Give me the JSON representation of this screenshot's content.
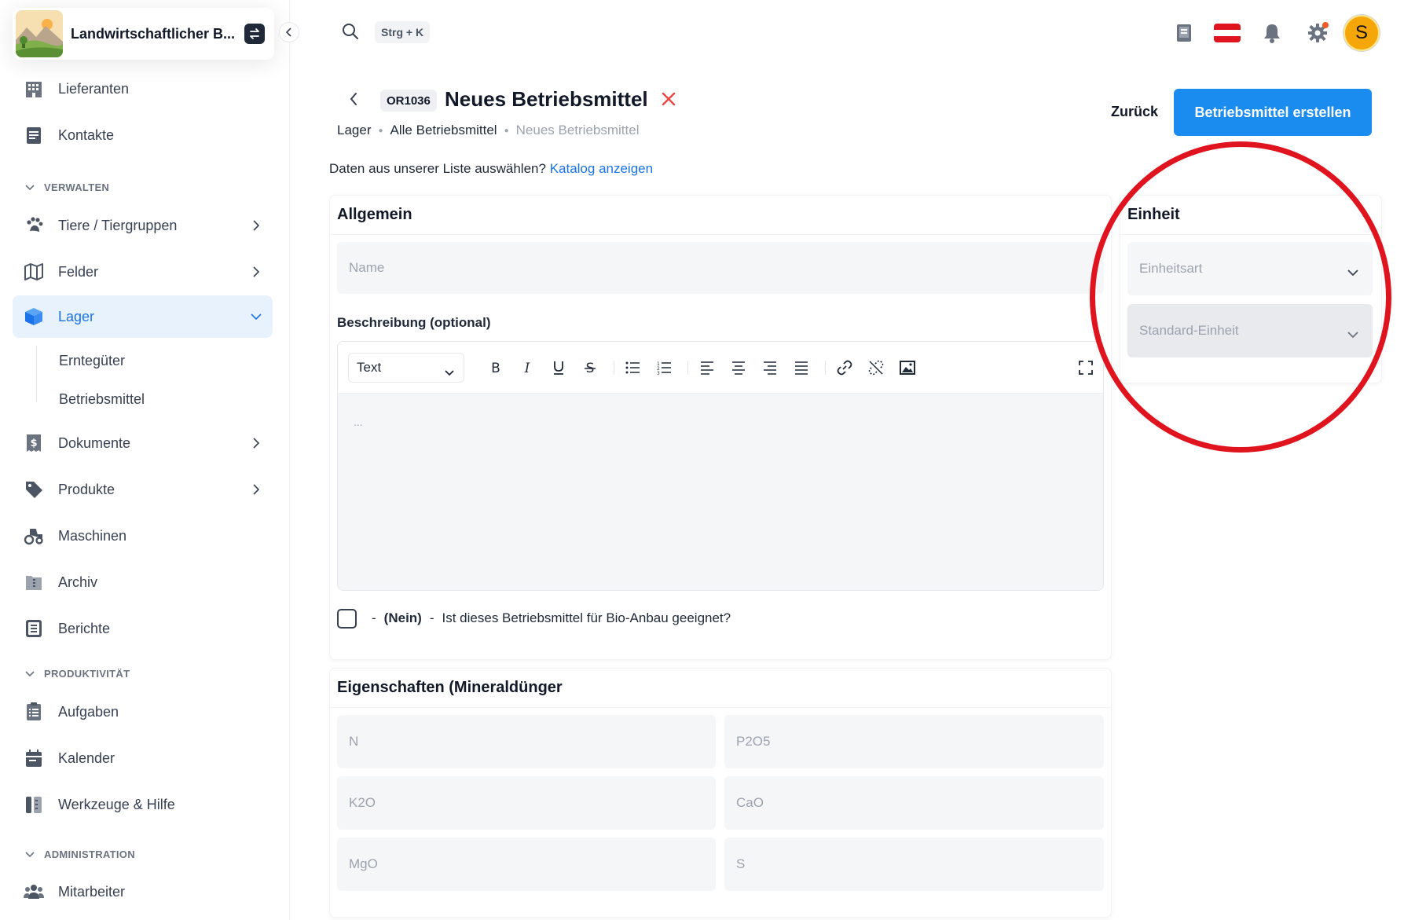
{
  "brand": {
    "name": "Landwirtschaftlicher B..."
  },
  "sidebar": {
    "items_top": [
      {
        "label": "Lieferanten",
        "icon": "building-icon"
      },
      {
        "label": "Kontakte",
        "icon": "contacts-icon"
      }
    ],
    "sections": {
      "manage": "VERWALTEN",
      "productivity": "PRODUKTIVITÄT",
      "admin": "ADMINISTRATION"
    },
    "manage_items": [
      {
        "label": "Tiere / Tiergruppen",
        "icon": "paw-icon"
      },
      {
        "label": "Felder",
        "icon": "map-icon"
      },
      {
        "label": "Lager",
        "icon": "box-icon"
      },
      {
        "label": "Dokumente",
        "icon": "invoice-icon"
      },
      {
        "label": "Produkte",
        "icon": "tag-icon"
      },
      {
        "label": "Maschinen",
        "icon": "tractor-icon"
      },
      {
        "label": "Archiv",
        "icon": "archive-icon"
      },
      {
        "label": "Berichte",
        "icon": "report-icon"
      }
    ],
    "lager_sub": [
      "Erntegüter",
      "Betriebsmittel"
    ],
    "productivity_items": [
      {
        "label": "Aufgaben",
        "icon": "tasks-icon"
      },
      {
        "label": "Kalender",
        "icon": "calendar-icon"
      },
      {
        "label": "Werkzeuge & Hilfe",
        "icon": "tools-icon"
      }
    ],
    "admin_items": [
      {
        "label": "Mitarbeiter",
        "icon": "users-icon"
      }
    ]
  },
  "header": {
    "shortcut": "Strg + K",
    "avatar_initial": "S",
    "colors": {
      "accent": "#1a8cf0",
      "avatar": "#f5a70a",
      "notify_dot": "#f05a28"
    }
  },
  "page": {
    "code": "OR1036",
    "title": "Neues Betriebsmittel",
    "breadcrumbs": [
      "Lager",
      "Alle Betriebsmittel",
      "Neues Betriebsmittel"
    ],
    "back_label": "Zurück",
    "create_label": "Betriebsmittel erstellen",
    "hint_text": "Daten aus unserer Liste auswählen?",
    "hint_link": "Katalog anzeigen"
  },
  "general": {
    "title": "Allgemein",
    "name_placeholder": "Name",
    "description_label": "Beschreibung (optional)",
    "editor_format": "Text",
    "editor_placeholder": "...",
    "bio_state": "(Nein)",
    "bio_question": "Ist dieses Betriebsmittel für Bio-Anbau geeignet?",
    "dash": "-"
  },
  "unit": {
    "title": "Einheit",
    "type_placeholder": "Einheitsart",
    "standard_placeholder": "Standard-Einheit"
  },
  "properties": {
    "title": "Eigenschaften (Mineraldünger",
    "fields": [
      "N",
      "P2O5",
      "K2O",
      "CaO",
      "MgO",
      "S"
    ]
  },
  "annotation": {
    "color": "#e0141e"
  }
}
